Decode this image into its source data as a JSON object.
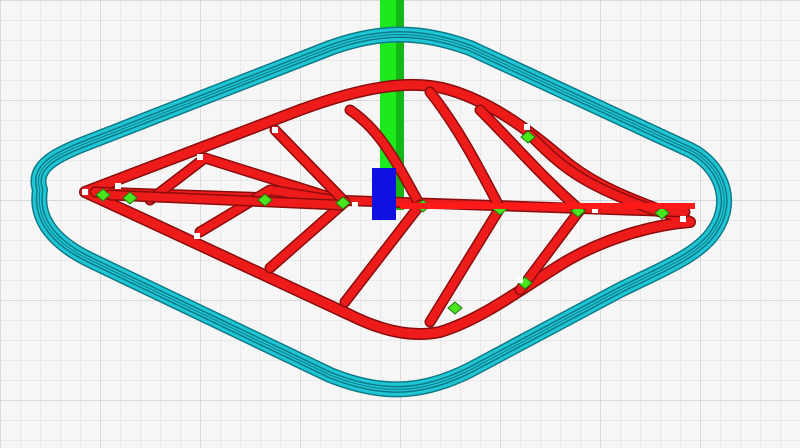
{
  "app": {
    "view": "slicer-layer-preview"
  },
  "colors": {
    "background": "#f6f6f6",
    "grid_minor": "#d9d9d9",
    "grid_major": "#c9c9c9",
    "skirt_fill": "#1fc6d6",
    "skirt_stroke": "#0e7a86",
    "wall_fill": "#ee1b1b",
    "wall_stroke": "#8a0c0c",
    "infill_fill": "#49e51d",
    "axis_y": "#1cea1c",
    "axis_z": "#1010e0",
    "axis_x": "#ff1a1a",
    "node_marker": "#ffffff"
  },
  "layers": {
    "skirt": {
      "name": "skirt",
      "line_count": 3
    },
    "leaf_outline": {
      "name": "outer-wall"
    },
    "veins": {
      "name": "inner-walls",
      "count": 13
    },
    "infill": {
      "name": "infill",
      "count": 11
    }
  },
  "axes": {
    "x": {
      "color_name": "red"
    },
    "y": {
      "color_name": "green"
    },
    "z": {
      "color_name": "blue"
    }
  },
  "icons": {
    "origin": "origin-axis-icon"
  }
}
